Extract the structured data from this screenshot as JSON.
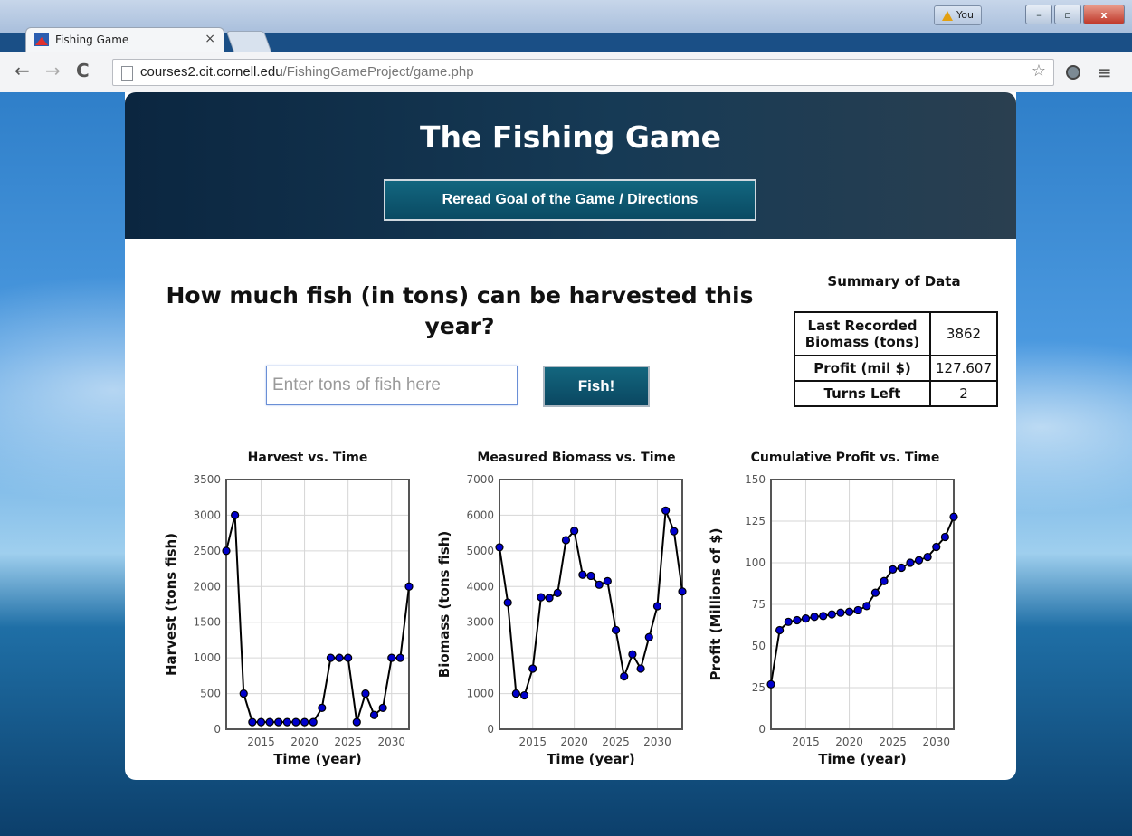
{
  "browser": {
    "tab_title": "Fishing Game",
    "tab_close": "×",
    "user_label": "You",
    "url_host": "courses2.cit.cornell.edu",
    "url_path": "/FishingGameProject/game.php",
    "window_controls": {
      "minimize": "–",
      "maximize": "▫",
      "close": "x"
    },
    "icons": [
      "back-arrow-icon",
      "forward-arrow-icon",
      "reload-icon",
      "page-icon",
      "star-icon",
      "extension-icon",
      "menu-icon"
    ]
  },
  "game": {
    "title": "The Fishing Game",
    "directions_label": "Reread Goal of the Game / Directions",
    "question": "How much fish (in tons) can be harvested this year?",
    "input_placeholder": "Enter tons of fish here",
    "fish_button": "Fish!",
    "summary": {
      "title": "Summary of Data",
      "rows": [
        {
          "label": "Last Recorded Biomass (tons)",
          "value": "3862"
        },
        {
          "label": "Profit (mil $)",
          "value": "127.607"
        },
        {
          "label": "Turns Left",
          "value": "2"
        }
      ]
    }
  },
  "chart_data": [
    {
      "type": "line",
      "title": "Harvest vs. Time",
      "xlabel": "Time (year)",
      "ylabel": "Harvest (tons fish)",
      "xlim": [
        2011,
        2032
      ],
      "ylim": [
        0,
        3500
      ],
      "xticks": [
        2015,
        2020,
        2025,
        2030
      ],
      "yticks": [
        0,
        500,
        1000,
        1500,
        2000,
        2500,
        3000,
        3500
      ],
      "grid": true,
      "x": [
        2011,
        2012,
        2013,
        2014,
        2015,
        2016,
        2017,
        2018,
        2019,
        2020,
        2021,
        2022,
        2023,
        2024,
        2025,
        2026,
        2027,
        2028,
        2029,
        2030,
        2031,
        2032
      ],
      "y": [
        2500,
        3000,
        500,
        100,
        100,
        100,
        100,
        100,
        100,
        100,
        100,
        300,
        1000,
        1000,
        1000,
        100,
        500,
        200,
        300,
        1000,
        1000,
        2000
      ]
    },
    {
      "type": "line",
      "title": "Measured Biomass vs. Time",
      "xlabel": "Time (year)",
      "ylabel": "Biomass (tons fish)",
      "xlim": [
        2011,
        2033
      ],
      "ylim": [
        0,
        7000
      ],
      "xticks": [
        2015,
        2020,
        2025,
        2030
      ],
      "yticks": [
        0,
        1000,
        2000,
        3000,
        4000,
        5000,
        6000,
        7000
      ],
      "grid": true,
      "x": [
        2011,
        2012,
        2013,
        2014,
        2015,
        2016,
        2017,
        2018,
        2019,
        2020,
        2021,
        2022,
        2023,
        2024,
        2025,
        2026,
        2027,
        2028,
        2029,
        2030,
        2031,
        2032,
        2033
      ],
      "y": [
        5100,
        3550,
        1000,
        950,
        1700,
        3700,
        3680,
        3820,
        5300,
        5560,
        4330,
        4300,
        4050,
        4150,
        2780,
        1480,
        2100,
        1700,
        2580,
        3450,
        6130,
        5550,
        3862
      ]
    },
    {
      "type": "line",
      "title": "Cumulative Profit vs. Time",
      "xlabel": "Time (year)",
      "ylabel": "Profit (Millions of $)",
      "xlim": [
        2011,
        2032
      ],
      "ylim": [
        0,
        150
      ],
      "xticks": [
        2015,
        2020,
        2025,
        2030
      ],
      "yticks": [
        0,
        25,
        50,
        75,
        100,
        125,
        150
      ],
      "grid": true,
      "x": [
        2011,
        2012,
        2013,
        2014,
        2015,
        2016,
        2017,
        2018,
        2019,
        2020,
        2021,
        2022,
        2023,
        2024,
        2025,
        2026,
        2027,
        2028,
        2029,
        2030,
        2031,
        2032
      ],
      "y": [
        27,
        59.5,
        64.5,
        65.5,
        66.5,
        67.5,
        68,
        69,
        70,
        70.5,
        71.5,
        74,
        82,
        89,
        96,
        97,
        100,
        101.5,
        103.5,
        109.5,
        115.5,
        127.6
      ]
    }
  ],
  "colors": {
    "header_dark": "#0b2640",
    "button_teal": "#0a4a63",
    "marker_fill": "#0000cc",
    "line": "#000000"
  }
}
